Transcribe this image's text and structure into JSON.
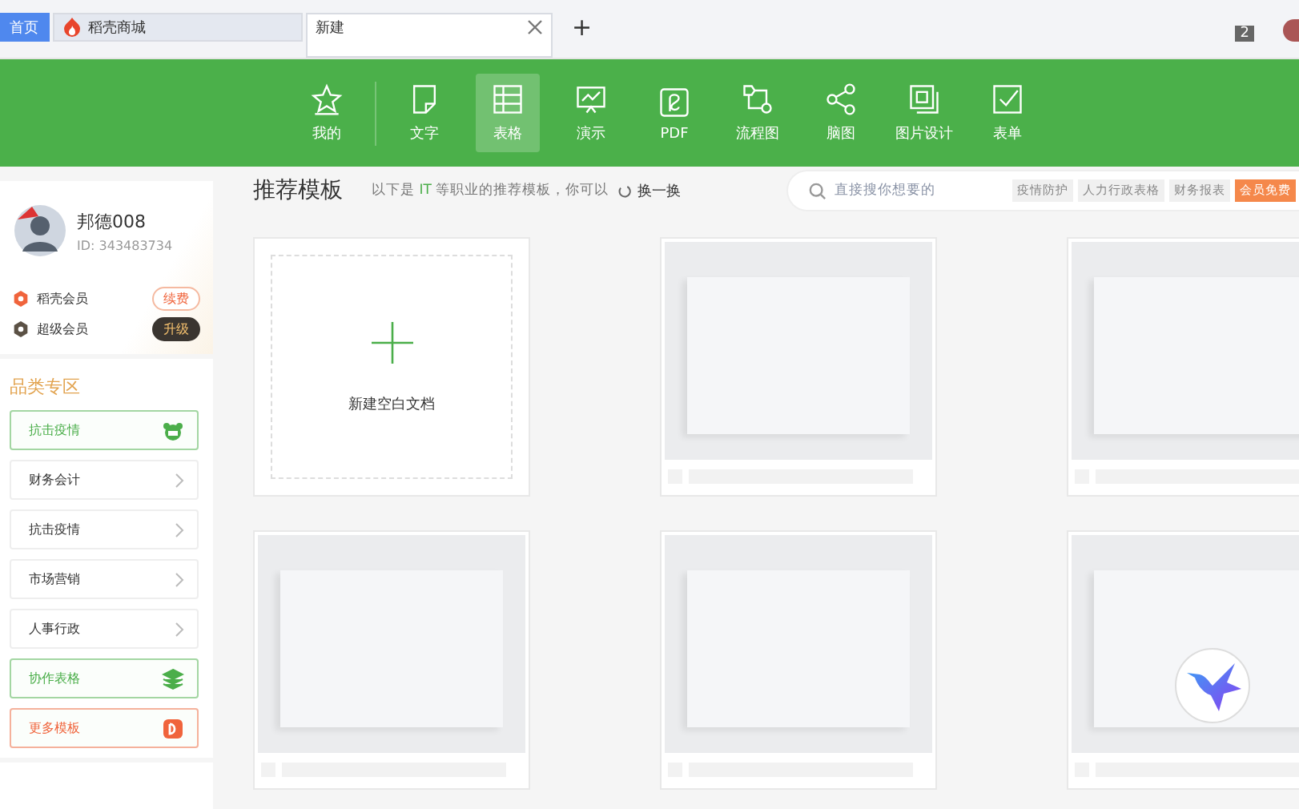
{
  "tabs": [
    {
      "kind": "home",
      "label": "首页",
      "selected": false
    },
    {
      "kind": "store",
      "label": "稻壳商城",
      "selected": false
    },
    {
      "kind": "doc",
      "label": "新建",
      "selected": true
    }
  ],
  "tab_actions": {
    "new_tab": "+",
    "window_count": "2"
  },
  "nav": [
    {
      "kind": "star",
      "label": "我的",
      "selected": false
    },
    {
      "kind": "text",
      "label": "文字",
      "selected": false
    },
    {
      "kind": "table",
      "label": "表格",
      "selected": true
    },
    {
      "kind": "slides",
      "label": "演示",
      "selected": false
    },
    {
      "kind": "pdf",
      "label": "PDF",
      "selected": false
    },
    {
      "kind": "flow",
      "label": "流程图",
      "selected": false
    },
    {
      "kind": "mind",
      "label": "脑图",
      "selected": false
    },
    {
      "kind": "image",
      "label": "图片设计",
      "selected": false
    },
    {
      "kind": "form",
      "label": "表单",
      "selected": false
    }
  ],
  "profile": {
    "name": "邦德008",
    "id": "ID: 343483734",
    "memberships": [
      {
        "kind": "docer",
        "label": "稻壳会员",
        "action": "续费"
      },
      {
        "kind": "super",
        "label": "超级会员",
        "action": "升级"
      }
    ]
  },
  "categories": {
    "title": "品类专区",
    "items": [
      {
        "kind": "feature",
        "label": "抗击疫情",
        "color": "#4bae4a"
      },
      {
        "kind": "category",
        "label": "财务会计"
      },
      {
        "kind": "category",
        "label": "抗击疫情"
      },
      {
        "kind": "category",
        "label": "市场营销"
      },
      {
        "kind": "category",
        "label": "人事行政"
      },
      {
        "kind": "feature",
        "label": "协作表格",
        "color": "#4bae4a"
      },
      {
        "kind": "feature",
        "label": "更多模板",
        "color": "#f0643c"
      }
    ]
  },
  "header": {
    "title": "推荐模板",
    "description": "以下是 **IT** 等职业的推荐模板，你可以",
    "refresh": "换一换"
  },
  "search": {
    "placeholder": "直接搜你想要的",
    "tags": [
      {
        "label": "疫情防护",
        "kind": "plain"
      },
      {
        "label": "人力行政表格",
        "kind": "plain"
      },
      {
        "label": "财务报表",
        "kind": "plain"
      },
      {
        "label": "会员免费",
        "kind": "promo"
      }
    ]
  },
  "templates": [
    {
      "kind": "blank",
      "label": "新建空白文档"
    },
    {
      "kind": "template"
    },
    {
      "kind": "template"
    },
    {
      "kind": "template"
    },
    {
      "kind": "template"
    },
    {
      "kind": "template"
    }
  ]
}
